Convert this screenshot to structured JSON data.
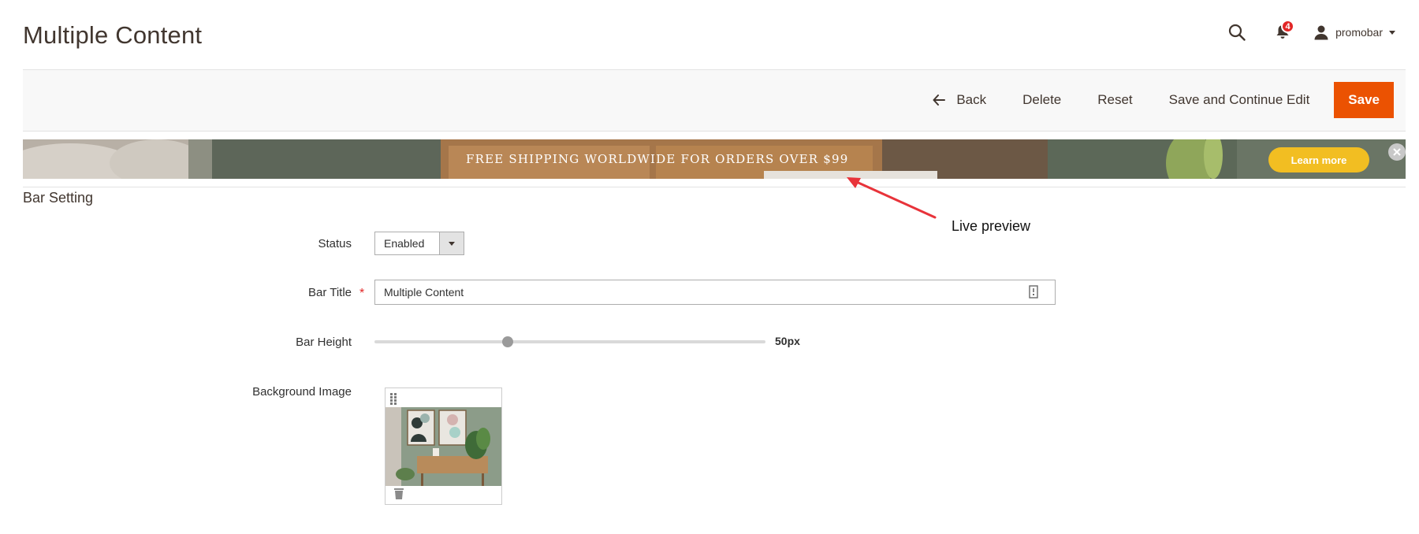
{
  "header": {
    "title": "Multiple Content",
    "notification_count": "4",
    "user_name": "promobar"
  },
  "actions": {
    "back_label": "Back",
    "delete_label": "Delete",
    "reset_label": "Reset",
    "save_continue_label": "Save and Continue Edit",
    "save_label": "Save"
  },
  "preview": {
    "text": "FREE SHIPPING WORLDWIDE FOR ORDERS OVER $99",
    "button_label": "Learn more",
    "button_color": "#f2be22"
  },
  "annotation": {
    "label": "Live preview",
    "color": "#e8333a"
  },
  "section": {
    "title": "Bar Setting"
  },
  "form": {
    "status_label": "Status",
    "status_value": "Enabled",
    "title_label": "Bar Title",
    "title_value": "Multiple Content",
    "height_label": "Bar Height",
    "height_value_text": "50px",
    "height_fraction": 0.34,
    "bg_image_label": "Background Image"
  },
  "colors": {
    "accent": "#eb5202",
    "badge": "#e22626"
  }
}
